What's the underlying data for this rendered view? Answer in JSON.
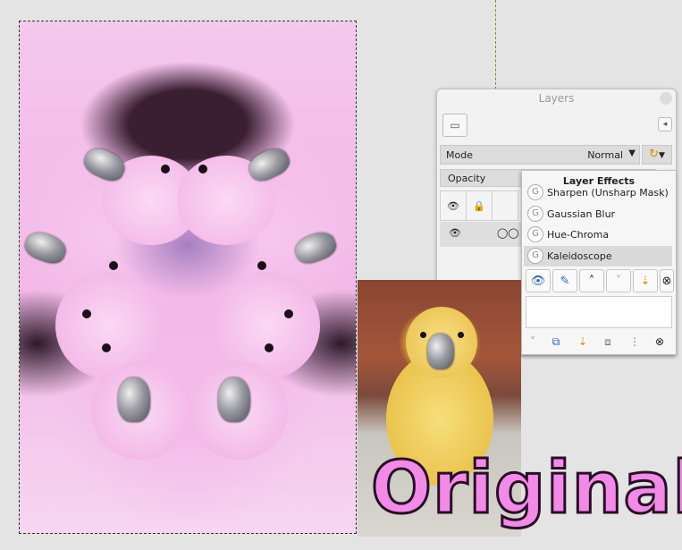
{
  "layers_dialog": {
    "title": "Layers",
    "mode_label": "Mode",
    "mode_value": "Normal",
    "opacity_label": "Opacity"
  },
  "layer_effects": {
    "title": "Layer Effects",
    "items": [
      {
        "label": "Sharpen (Unsharp Mask)",
        "icon": "gegl-icon"
      },
      {
        "label": "Gaussian Blur",
        "icon": "gegl-icon"
      },
      {
        "label": "Hue-Chroma",
        "icon": "gegl-icon"
      },
      {
        "label": "Kaleidoscope",
        "icon": "gegl-icon",
        "selected": true
      }
    ]
  },
  "overlay": {
    "caption": "Original"
  },
  "colors": {
    "caption_fill": "#f28be8",
    "caption_stroke": "#2a0d27",
    "canvas_pink": "#f2b4e6"
  }
}
